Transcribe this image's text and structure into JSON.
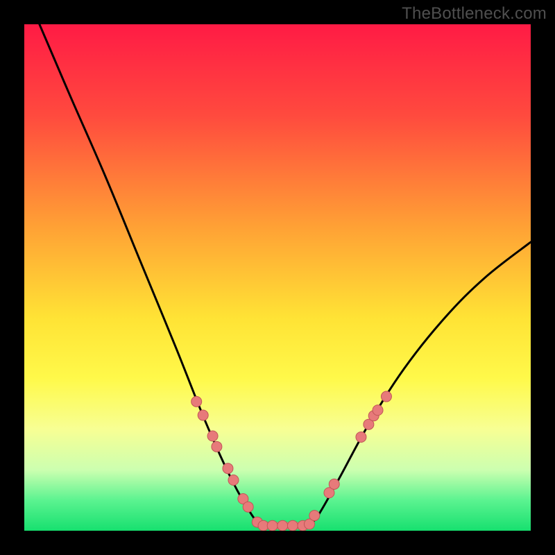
{
  "watermark": "TheBottleneck.com",
  "colors": {
    "bg_black": "#000000",
    "curve": "#000000",
    "dot_fill": "#e77a7a",
    "dot_stroke": "#c15656",
    "green_band": "#17e06f"
  },
  "chart_data": {
    "type": "line",
    "title": "",
    "xlabel": "",
    "ylabel": "",
    "xlim": [
      0,
      100
    ],
    "ylim": [
      0,
      100
    ],
    "gradient_stops": [
      {
        "offset": 0,
        "color": "#ff1b45"
      },
      {
        "offset": 18,
        "color": "#ff4a3e"
      },
      {
        "offset": 40,
        "color": "#ffa135"
      },
      {
        "offset": 58,
        "color": "#ffe335"
      },
      {
        "offset": 70,
        "color": "#fff94a"
      },
      {
        "offset": 80,
        "color": "#f7ff94"
      },
      {
        "offset": 88,
        "color": "#ccffb0"
      },
      {
        "offset": 94,
        "color": "#5bf390"
      },
      {
        "offset": 100,
        "color": "#17e06f"
      }
    ],
    "series": [
      {
        "name": "left_curve",
        "points": [
          {
            "x": 3,
            "y": 100
          },
          {
            "x": 9,
            "y": 86
          },
          {
            "x": 16,
            "y": 70
          },
          {
            "x": 23,
            "y": 53
          },
          {
            "x": 30,
            "y": 36
          },
          {
            "x": 36,
            "y": 21
          },
          {
            "x": 41,
            "y": 10
          },
          {
            "x": 45,
            "y": 3
          },
          {
            "x": 47,
            "y": 1.0
          }
        ]
      },
      {
        "name": "flat_min",
        "points": [
          {
            "x": 47,
            "y": 1.0
          },
          {
            "x": 56,
            "y": 1.0
          }
        ]
      },
      {
        "name": "right_curve",
        "points": [
          {
            "x": 56,
            "y": 1.0
          },
          {
            "x": 58,
            "y": 3
          },
          {
            "x": 62,
            "y": 10
          },
          {
            "x": 68,
            "y": 21
          },
          {
            "x": 75,
            "y": 32
          },
          {
            "x": 83,
            "y": 42
          },
          {
            "x": 91,
            "y": 50
          },
          {
            "x": 100,
            "y": 57
          }
        ]
      }
    ],
    "dots": [
      {
        "x": 34.0,
        "y": 25.5
      },
      {
        "x": 35.3,
        "y": 22.8
      },
      {
        "x": 37.2,
        "y": 18.7
      },
      {
        "x": 38.0,
        "y": 16.6
      },
      {
        "x": 40.2,
        "y": 12.3
      },
      {
        "x": 41.3,
        "y": 10.0
      },
      {
        "x": 43.2,
        "y": 6.3
      },
      {
        "x": 44.2,
        "y": 4.7
      },
      {
        "x": 46.0,
        "y": 1.7
      },
      {
        "x": 47.2,
        "y": 1.0
      },
      {
        "x": 49.0,
        "y": 1.0
      },
      {
        "x": 51.0,
        "y": 1.0
      },
      {
        "x": 53.0,
        "y": 1.0
      },
      {
        "x": 55.0,
        "y": 1.0
      },
      {
        "x": 56.3,
        "y": 1.3
      },
      {
        "x": 57.3,
        "y": 3.0
      },
      {
        "x": 60.2,
        "y": 7.5
      },
      {
        "x": 61.2,
        "y": 9.2
      },
      {
        "x": 66.5,
        "y": 18.5
      },
      {
        "x": 68.0,
        "y": 21.0
      },
      {
        "x": 69.0,
        "y": 22.7
      },
      {
        "x": 69.8,
        "y": 23.8
      },
      {
        "x": 71.5,
        "y": 26.5
      }
    ]
  }
}
